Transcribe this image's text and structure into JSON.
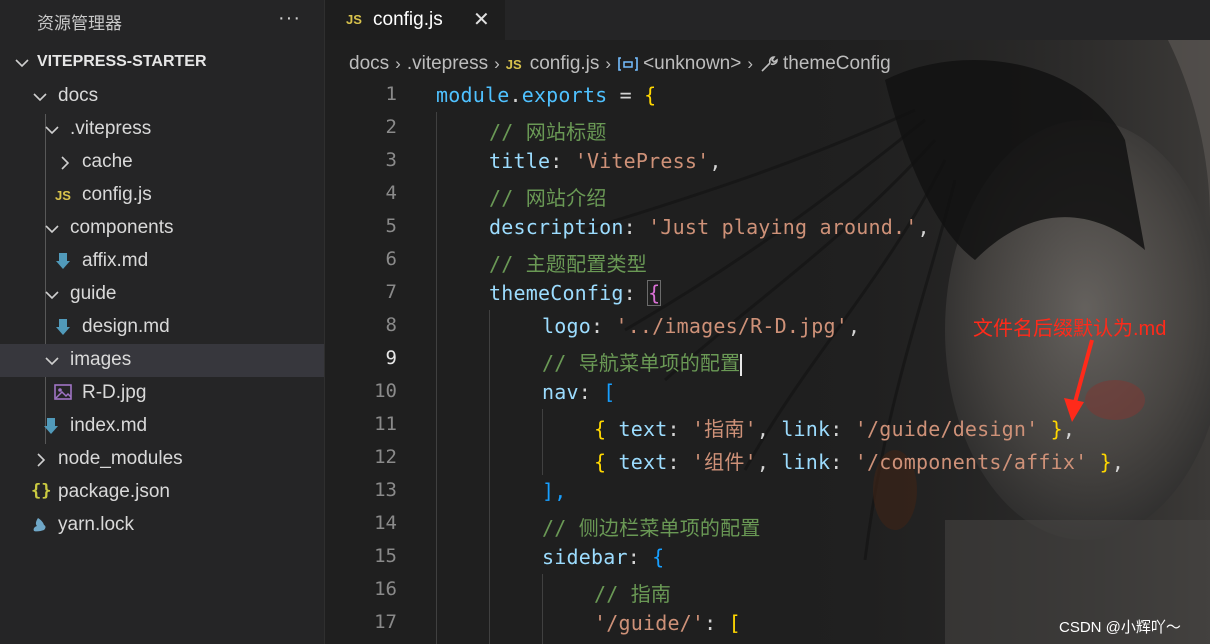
{
  "sidebar": {
    "title": "资源管理器",
    "more_label": "···",
    "project": "VITEPRESS-STARTER",
    "items": [
      {
        "label": "docs"
      },
      {
        "label": ".vitepress"
      },
      {
        "label": "cache"
      },
      {
        "label": "config.js"
      },
      {
        "label": "components"
      },
      {
        "label": "affix.md"
      },
      {
        "label": "guide"
      },
      {
        "label": "design.md"
      },
      {
        "label": "images"
      },
      {
        "label": "R-D.jpg"
      },
      {
        "label": "index.md"
      },
      {
        "label": "node_modules"
      },
      {
        "label": "package.json"
      },
      {
        "label": "yarn.lock"
      }
    ]
  },
  "tab": {
    "badge": "JS",
    "label": "config.js",
    "close": "✕"
  },
  "breadcrumb": {
    "items": [
      "docs",
      ".vitepress",
      "config.js",
      "<unknown>",
      "themeConfig"
    ],
    "badge": "JS"
  },
  "code": {
    "active_line": 9,
    "lines": [
      {
        "n": "1"
      },
      {
        "n": "2"
      },
      {
        "n": "3"
      },
      {
        "n": "4"
      },
      {
        "n": "5"
      },
      {
        "n": "6"
      },
      {
        "n": "7"
      },
      {
        "n": "8"
      },
      {
        "n": "9"
      },
      {
        "n": "10"
      },
      {
        "n": "11"
      },
      {
        "n": "12"
      },
      {
        "n": "13"
      },
      {
        "n": "14"
      },
      {
        "n": "15"
      },
      {
        "n": "16"
      },
      {
        "n": "17"
      }
    ],
    "tokens": {
      "module": "module",
      "exports": "exports",
      "eq": " = ",
      "lbrace": "{",
      "c_site_title": "// 网站标题",
      "title_key": "title",
      "title_val": "'VitePress'",
      "c_site_intro": "// 网站介绍",
      "desc_key": "description",
      "desc_val": "'Just playing around.'",
      "c_theme": "// 主题配置类型",
      "theme_key": "themeConfig",
      "logo_key": "logo",
      "logo_val": "'../images/R-D.jpg'",
      "c_nav": "// 导航菜单项的配置",
      "nav_key": "nav",
      "lbracket": "[",
      "text_key": "text",
      "link_key": "link",
      "nav1_text": "'指南'",
      "nav1_link": "'/guide/design'",
      "nav2_text": "'组件'",
      "nav2_link": "'/components/affix'",
      "close_bracket": "],",
      "c_sidebar": "// 侧边栏菜单项的配置",
      "sidebar_key": "sidebar",
      "c_guide": "// 指南",
      "guide_key": "'/guide/'"
    }
  },
  "annotation": "文件名后缀默认为.md",
  "watermark": "CSDN @小辉吖～",
  "colors": {
    "keyword_var": "#4fc1ff",
    "property": "#9cdcfe",
    "string": "#ce9178",
    "comment": "#6a9955",
    "annotation": "#ff2a1a"
  }
}
